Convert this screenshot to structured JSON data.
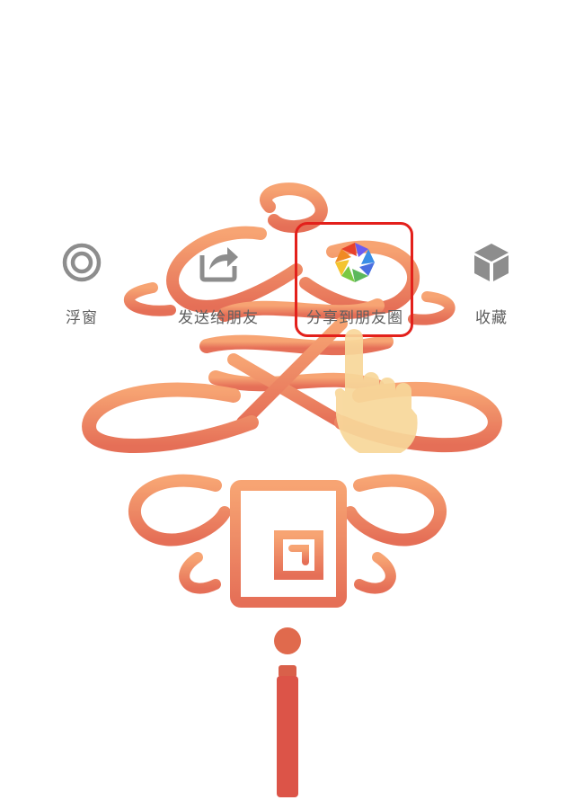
{
  "share_menu": {
    "items": [
      {
        "id": "float-window",
        "label": "浮窗",
        "icon": "floating-window-icon"
      },
      {
        "id": "send-to-friend",
        "label": "发送给朋友",
        "icon": "share-forward-icon"
      },
      {
        "id": "share-to-moments",
        "label": "分享到朋友圈",
        "icon": "moments-aperture-icon"
      },
      {
        "id": "favorite",
        "label": "收藏",
        "icon": "favorite-cube-icon"
      }
    ],
    "highlighted_item": "share-to-moments"
  },
  "colors": {
    "icon_gray": "#8d8d8d",
    "label_gray": "#5f5f5f",
    "highlight_red": "#e3201b",
    "knot_orange": "#ee8e5a",
    "tassel_red": "#dc5448",
    "hand_skin": "#f8d79a"
  }
}
